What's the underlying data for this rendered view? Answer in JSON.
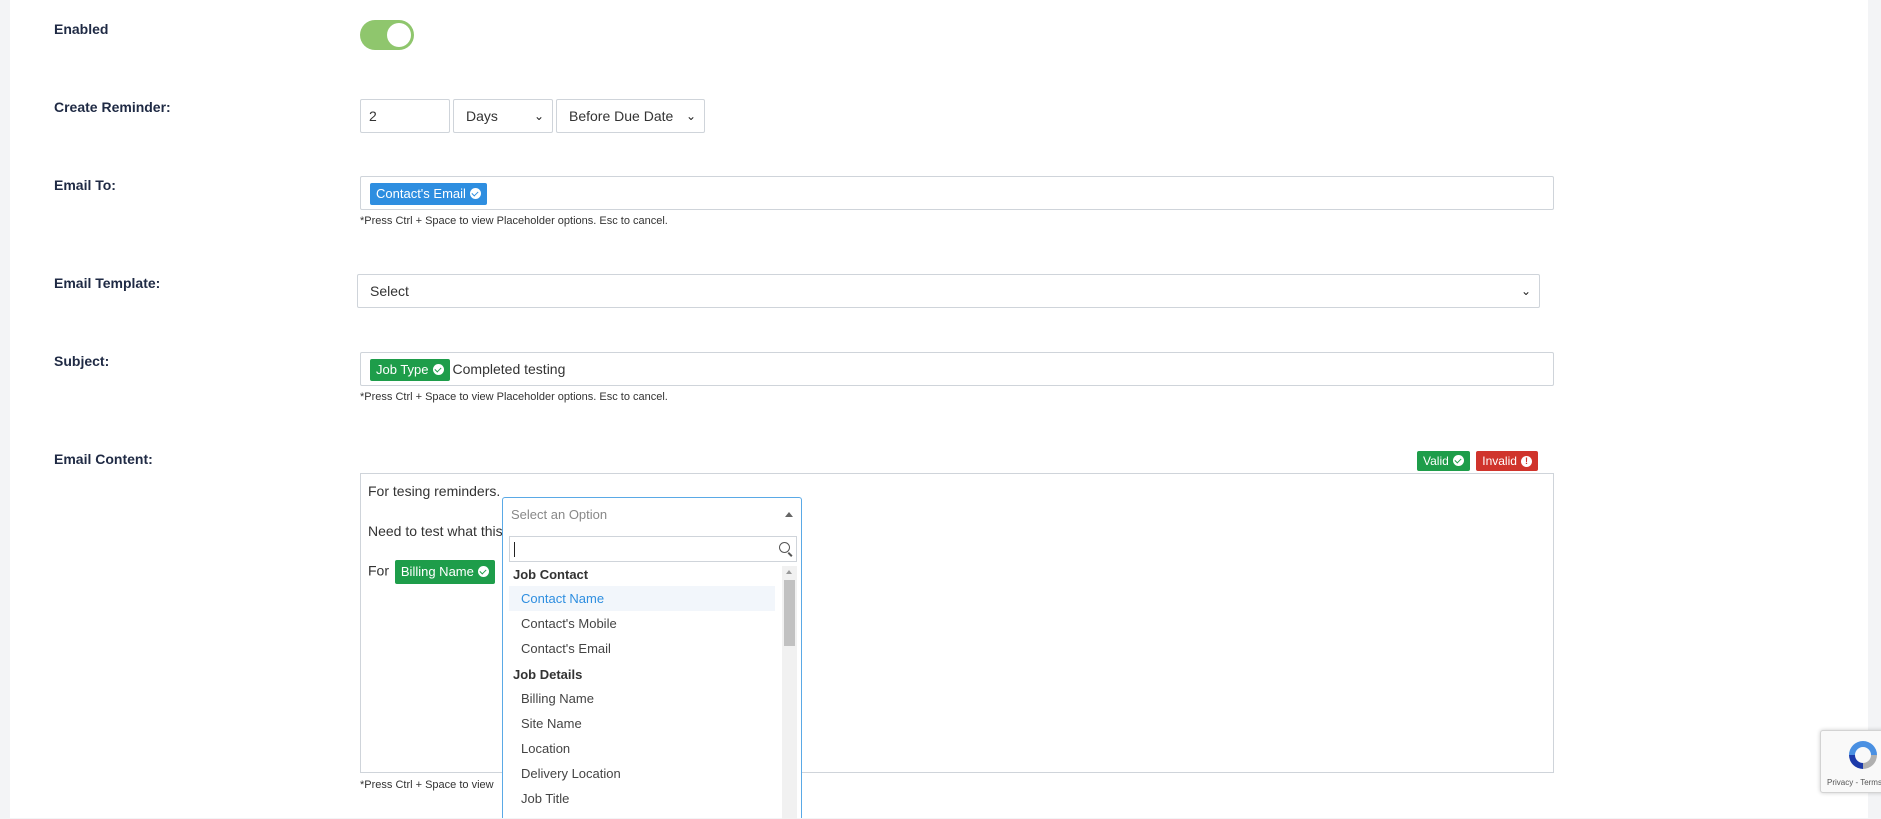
{
  "form": {
    "enabled_label": "Enabled",
    "enabled_value": true,
    "create_reminder_label": "Create Reminder:",
    "reminder_amount": "2",
    "reminder_unit": "Days",
    "reminder_relation": "Before Due Date",
    "email_to_label": "Email To:",
    "email_to_chip": "Contact's Email",
    "email_to_hint": "*Press Ctrl + Space to view Placeholder options. Esc to cancel.",
    "email_template_label": "Email Template:",
    "email_template_value": "Select",
    "subject_label": "Subject:",
    "subject_chip": "Job Type",
    "subject_text": "Completed testing",
    "subject_hint": "*Press Ctrl + Space to view Placeholder options. Esc to cancel.",
    "email_content_label": "Email Content:",
    "valid_badge": "Valid",
    "invalid_badge": "Invalid",
    "content_line1": "For tesing reminders.",
    "content_line2": "Need to test what this",
    "content_line3_prefix": "For",
    "content_chip": "Billing Name",
    "content_hint": "*Press Ctrl + Space to view"
  },
  "dropdown": {
    "placeholder": "Select an Option",
    "search_value": "",
    "groups": [
      {
        "label": "Job Contact",
        "items": [
          "Contact Name",
          "Contact's Mobile",
          "Contact's Email"
        ]
      },
      {
        "label": "Job Details",
        "items": [
          "Billing Name",
          "Site Name",
          "Location",
          "Delivery Location",
          "Job Title"
        ]
      }
    ],
    "highlighted": "Contact Name"
  },
  "recaptcha": {
    "text": "Privacy - Terms"
  },
  "colors": {
    "toggle_on": "#8fc66d",
    "chip_blue": "#2e8ee0",
    "chip_green": "#1e9d4a",
    "chip_red": "#d0342c",
    "dropdown_border": "#5aa9e6"
  }
}
